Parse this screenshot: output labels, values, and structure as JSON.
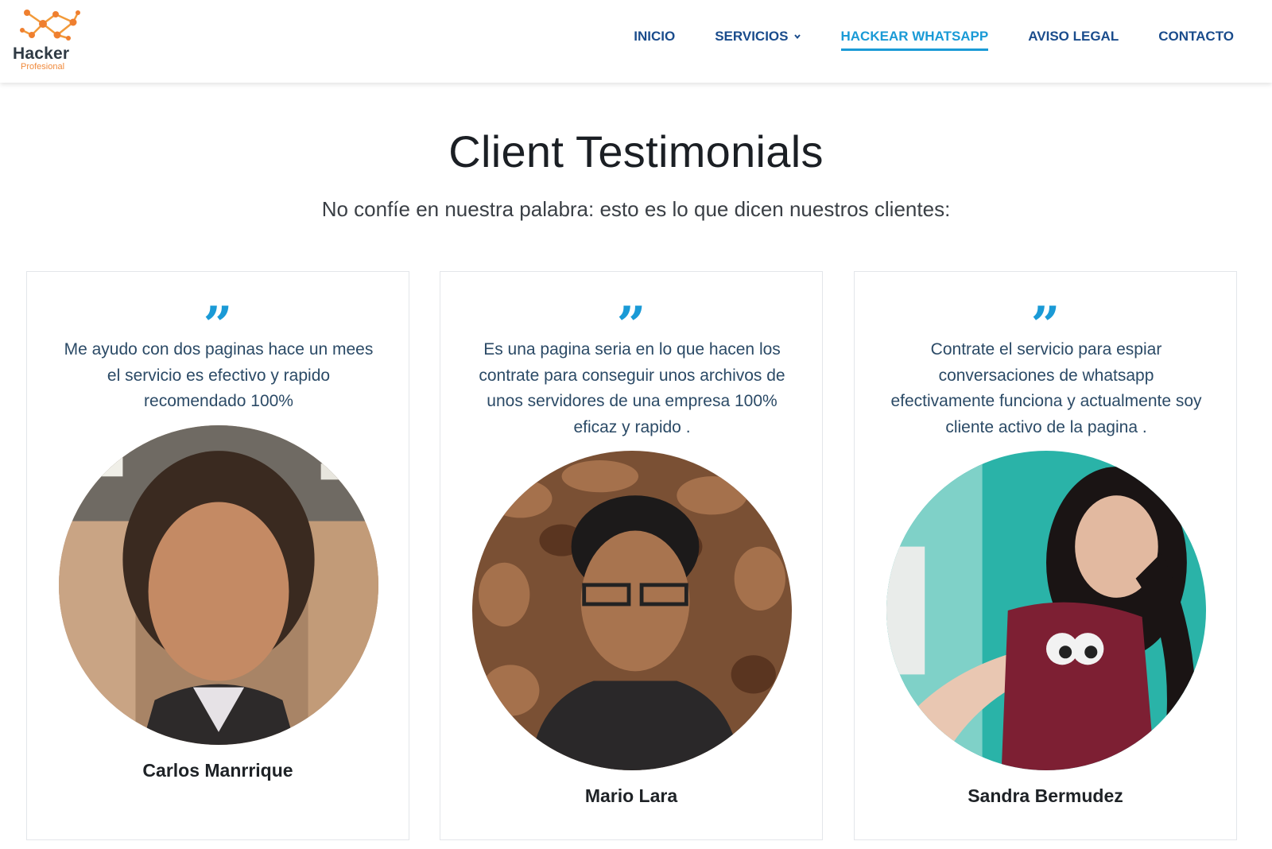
{
  "brand": {
    "title": "Hacker",
    "subtitle": "Profesional"
  },
  "nav": {
    "items": [
      {
        "label": "INICIO"
      },
      {
        "label": "SERVICIOS",
        "has_dropdown": true
      },
      {
        "label": "HACKEAR WHATSAPP",
        "active": true
      },
      {
        "label": "AVISO LEGAL"
      },
      {
        "label": "CONTACTO"
      }
    ]
  },
  "section": {
    "title": "Client Testimonials",
    "subtitle": "No confíe en nuestra palabra: esto es lo que dicen nuestros clientes:"
  },
  "testimonials": [
    {
      "quote_icon": "quote-icon",
      "text": "Me ayudo con dos paginas hace un mees el servicio es efectivo y rapido recomendado 100%",
      "name": "Carlos Manrrique"
    },
    {
      "quote_icon": "quote-icon",
      "text": "Es una pagina seria en lo que hacen los contrate para conseguir unos archivos de unos servidores de una empresa 100% eficaz y rapido .",
      "name": "Mario Lara"
    },
    {
      "quote_icon": "quote-icon",
      "text": "Contrate el servicio para espiar conversaciones de whatsapp efectivamente funciona y actualmente soy cliente activo de la pagina .",
      "name": "Sandra Bermudez"
    }
  ],
  "colors": {
    "accent": "#1a9ad6",
    "nav_text": "#1a4c8c",
    "quote_text": "#2b4a66",
    "logo_orange": "#f08a3c"
  }
}
